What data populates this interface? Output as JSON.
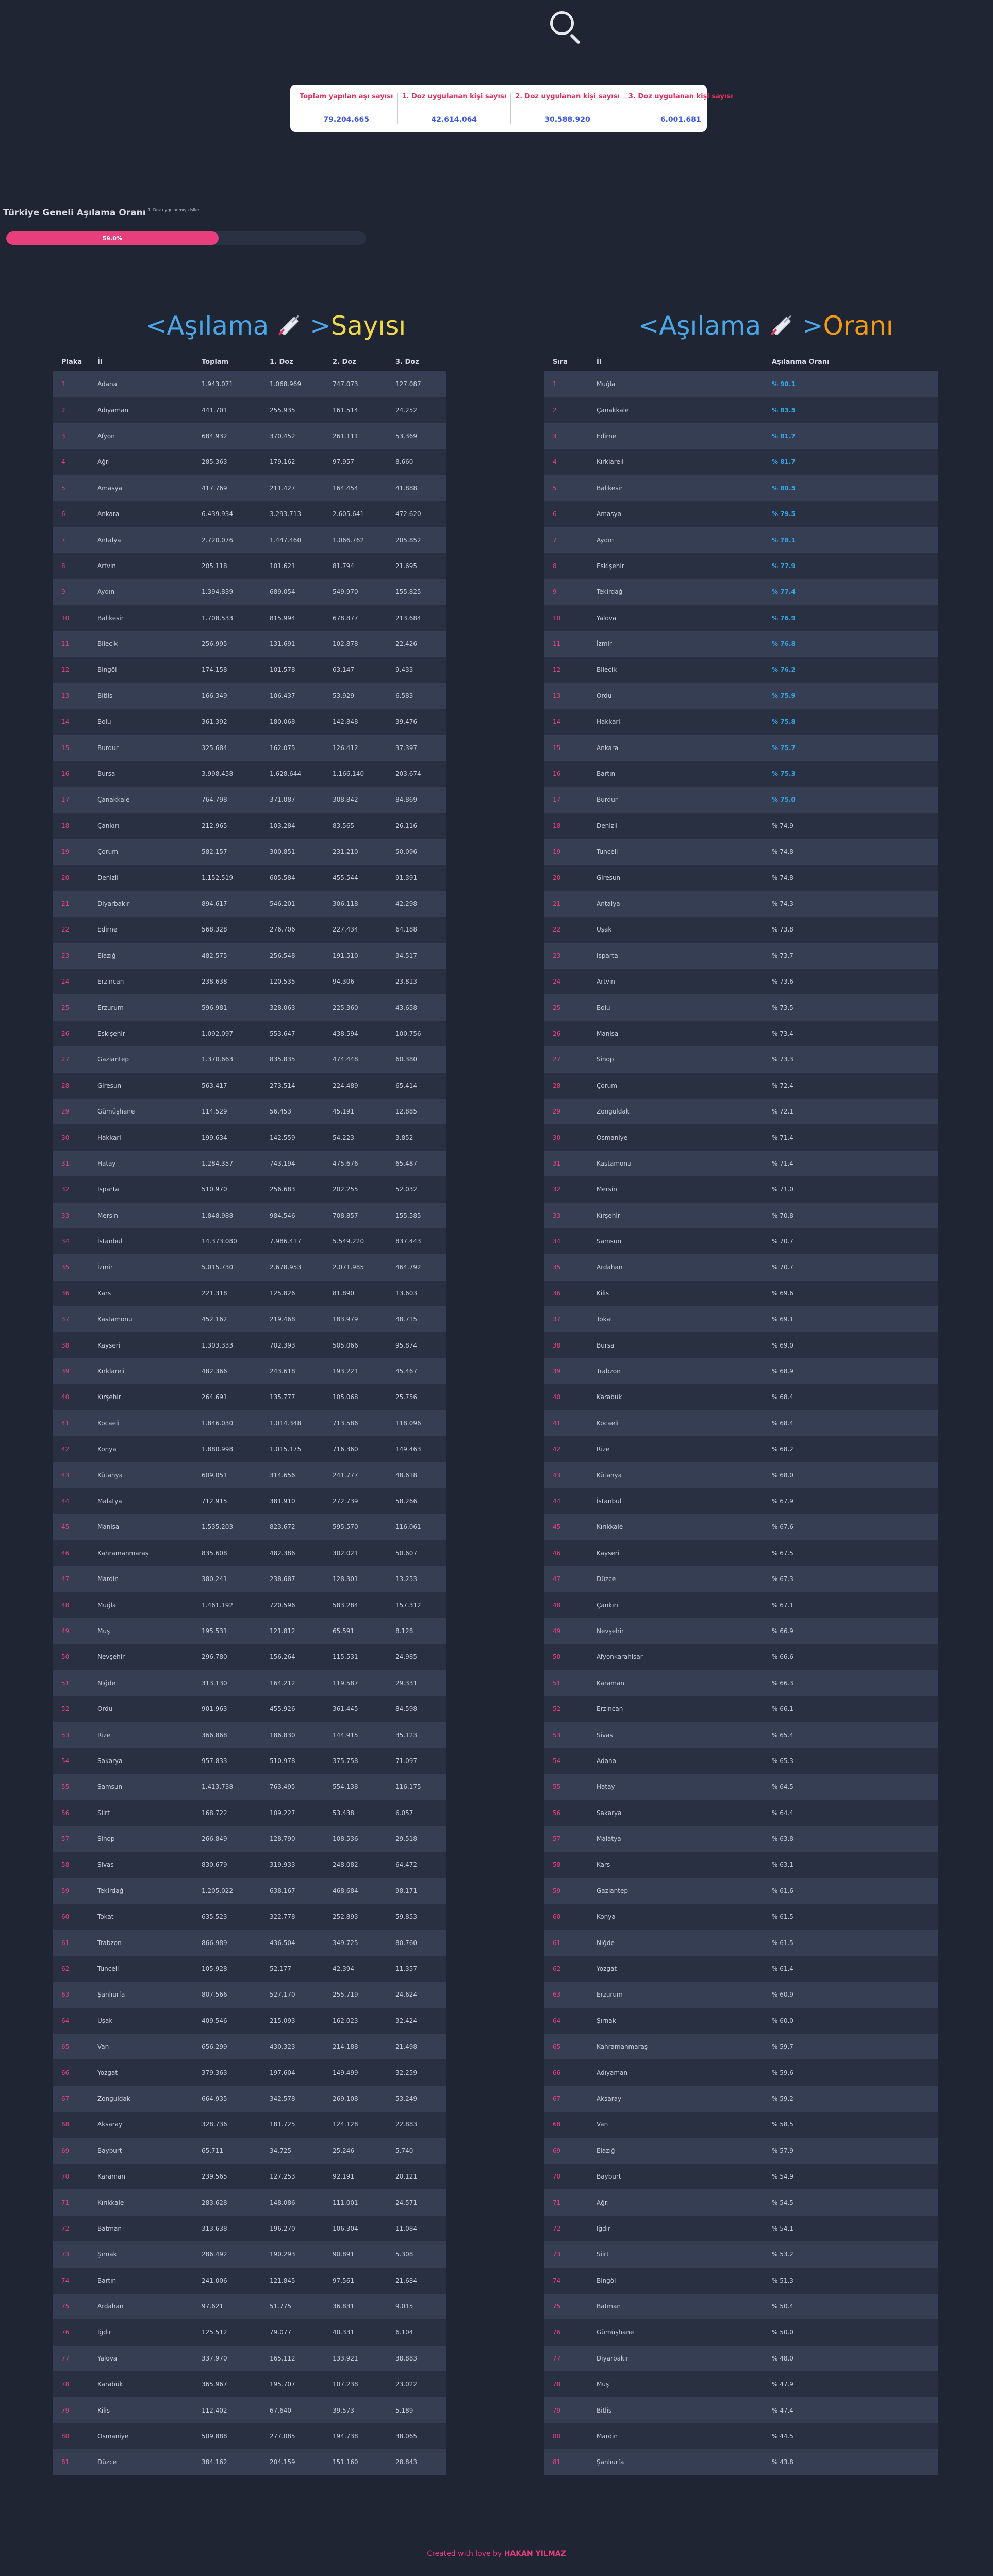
{
  "search": {
    "icon": "search-icon"
  },
  "stats": [
    {
      "label": "Toplam yapılan aşı sayısı",
      "value": "79.204.665"
    },
    {
      "label": "1. Doz uygulanan kişi sayısı",
      "value": "42.614.064"
    },
    {
      "label": "2. Doz uygulanan kişi sayısı",
      "value": "30.588.920"
    },
    {
      "label": "3. Doz uygulanan kişi sayısı",
      "value": "6.001.681"
    }
  ],
  "overall": {
    "title": "Türkiye Geneli Aşılama Oranı",
    "subtitle": "1. Doz uygulanmış kişiler",
    "percent_text": "59.0%",
    "percent": 59.0
  },
  "left_heading": {
    "open": "<",
    "word1": "Aşılama",
    "word2": "Sayısı",
    "close": ">",
    "icon": "syringe-icon"
  },
  "right_heading": {
    "open": "<",
    "word1": "Aşılama",
    "word2": "Oranı",
    "close": ">",
    "icon": "syringe-icon"
  },
  "left_table": {
    "headers": [
      "Plaka",
      "İl",
      "Toplam",
      "1. Doz",
      "2. Doz",
      "3. Doz"
    ],
    "rows": [
      [
        "1",
        "Adana",
        "1.943.071",
        "1.068.969",
        "747.073",
        "127.087"
      ],
      [
        "2",
        "Adıyaman",
        "441.701",
        "255.935",
        "161.514",
        "24.252"
      ],
      [
        "3",
        "Afyon",
        "684.932",
        "370.452",
        "261.111",
        "53.369"
      ],
      [
        "4",
        "Ağrı",
        "285.363",
        "179.162",
        "97.957",
        "8.660"
      ],
      [
        "5",
        "Amasya",
        "417.769",
        "211.427",
        "164.454",
        "41.888"
      ],
      [
        "6",
        "Ankara",
        "6.439.934",
        "3.293.713",
        "2.605.641",
        "472.620"
      ],
      [
        "7",
        "Antalya",
        "2.720.076",
        "1.447.460",
        "1.066.762",
        "205.852"
      ],
      [
        "8",
        "Artvin",
        "205.118",
        "101.621",
        "81.794",
        "21.695"
      ],
      [
        "9",
        "Aydın",
        "1.394.839",
        "689.054",
        "549.970",
        "155.825"
      ],
      [
        "10",
        "Balıkesir",
        "1.708.533",
        "815.994",
        "678.877",
        "213.684"
      ],
      [
        "11",
        "Bilecik",
        "256.995",
        "131.691",
        "102.878",
        "22.426"
      ],
      [
        "12",
        "Bingöl",
        "174.158",
        "101.578",
        "63.147",
        "9.433"
      ],
      [
        "13",
        "Bitlis",
        "166.349",
        "106.437",
        "53.929",
        "6.583"
      ],
      [
        "14",
        "Bolu",
        "361.392",
        "180.068",
        "142.848",
        "39.476"
      ],
      [
        "15",
        "Burdur",
        "325.684",
        "162.075",
        "126.412",
        "37.397"
      ],
      [
        "16",
        "Bursa",
        "3.998.458",
        "1.628.644",
        "1.166.140",
        "203.674"
      ],
      [
        "17",
        "Çanakkale",
        "764.798",
        "371.087",
        "308.842",
        "84.869"
      ],
      [
        "18",
        "Çankırı",
        "212.965",
        "103.284",
        "83.565",
        "26.116"
      ],
      [
        "19",
        "Çorum",
        "582.157",
        "300.851",
        "231.210",
        "50.096"
      ],
      [
        "20",
        "Denizli",
        "1.152.519",
        "605.584",
        "455.544",
        "91.391"
      ],
      [
        "21",
        "Diyarbakır",
        "894.617",
        "546.201",
        "306.118",
        "42.298"
      ],
      [
        "22",
        "Edirne",
        "568.328",
        "276.706",
        "227.434",
        "64.188"
      ],
      [
        "23",
        "Elazığ",
        "482.575",
        "256.548",
        "191.510",
        "34.517"
      ],
      [
        "24",
        "Erzincan",
        "238.638",
        "120.535",
        "94.306",
        "23.813"
      ],
      [
        "25",
        "Erzurum",
        "596.981",
        "328.063",
        "225.360",
        "43.658"
      ],
      [
        "26",
        "Eskişehir",
        "1.092.097",
        "553.647",
        "438.594",
        "100.756"
      ],
      [
        "27",
        "Gaziantep",
        "1.370.663",
        "835.835",
        "474.448",
        "60.380"
      ],
      [
        "28",
        "Giresun",
        "563.417",
        "273.514",
        "224.489",
        "65.414"
      ],
      [
        "29",
        "Gümüşhane",
        "114.529",
        "56.453",
        "45.191",
        "12.885"
      ],
      [
        "30",
        "Hakkari",
        "199.634",
        "142.559",
        "54.223",
        "3.852"
      ],
      [
        "31",
        "Hatay",
        "1.284.357",
        "743.194",
        "475.676",
        "65.487"
      ],
      [
        "32",
        "Isparta",
        "510.970",
        "256.683",
        "202.255",
        "52.032"
      ],
      [
        "33",
        "Mersin",
        "1.848.988",
        "984.546",
        "708.857",
        "155.585"
      ],
      [
        "34",
        "İstanbul",
        "14.373.080",
        "7.986.417",
        "5.549.220",
        "837.443"
      ],
      [
        "35",
        "İzmir",
        "5.015.730",
        "2.678.953",
        "2.071.985",
        "464.792"
      ],
      [
        "36",
        "Kars",
        "221.318",
        "125.826",
        "81.890",
        "13.603"
      ],
      [
        "37",
        "Kastamonu",
        "452.162",
        "219.468",
        "183.979",
        "48.715"
      ],
      [
        "38",
        "Kayseri",
        "1.303.333",
        "702.393",
        "505.066",
        "95.874"
      ],
      [
        "39",
        "Kırklareli",
        "482.366",
        "243.618",
        "193.221",
        "45.467"
      ],
      [
        "40",
        "Kırşehir",
        "264.691",
        "135.777",
        "105.068",
        "25.756"
      ],
      [
        "41",
        "Kocaeli",
        "1.846.030",
        "1.014.348",
        "713.586",
        "118.096"
      ],
      [
        "42",
        "Konya",
        "1.880.998",
        "1.015.175",
        "716.360",
        "149.463"
      ],
      [
        "43",
        "Kütahya",
        "609.051",
        "314.656",
        "241.777",
        "48.618"
      ],
      [
        "44",
        "Malatya",
        "712.915",
        "381.910",
        "272.739",
        "58.266"
      ],
      [
        "45",
        "Manisa",
        "1.535.203",
        "823.672",
        "595.570",
        "116.061"
      ],
      [
        "46",
        "Kahramanmaraş",
        "835.608",
        "482.386",
        "302.021",
        "50.607"
      ],
      [
        "47",
        "Mardin",
        "380.241",
        "238.687",
        "128.301",
        "13.253"
      ],
      [
        "48",
        "Muğla",
        "1.461.192",
        "720.596",
        "583.284",
        "157.312"
      ],
      [
        "49",
        "Muş",
        "195.531",
        "121.812",
        "65.591",
        "8.128"
      ],
      [
        "50",
        "Nevşehir",
        "296.780",
        "156.264",
        "115.531",
        "24.985"
      ],
      [
        "51",
        "Niğde",
        "313.130",
        "164.212",
        "119.587",
        "29.331"
      ],
      [
        "52",
        "Ordu",
        "901.963",
        "455.926",
        "361.445",
        "84.598"
      ],
      [
        "53",
        "Rize",
        "366.868",
        "186.830",
        "144.915",
        "35.123"
      ],
      [
        "54",
        "Sakarya",
        "957.833",
        "510.978",
        "375.758",
        "71.097"
      ],
      [
        "55",
        "Samsun",
        "1.413.738",
        "763.495",
        "554.138",
        "116.175"
      ],
      [
        "56",
        "Siirt",
        "168.722",
        "109.227",
        "53.438",
        "6.057"
      ],
      [
        "57",
        "Sinop",
        "266.849",
        "128.790",
        "108.536",
        "29.518"
      ],
      [
        "58",
        "Sivas",
        "830.679",
        "319.933",
        "248.082",
        "64.472"
      ],
      [
        "59",
        "Tekirdağ",
        "1.205.022",
        "638.167",
        "468.684",
        "98.171"
      ],
      [
        "60",
        "Tokat",
        "635.523",
        "322.778",
        "252.893",
        "59.853"
      ],
      [
        "61",
        "Trabzon",
        "866.989",
        "436.504",
        "349.725",
        "80.760"
      ],
      [
        "62",
        "Tunceli",
        "105.928",
        "52.177",
        "42.394",
        "11.357"
      ],
      [
        "63",
        "Şanlıurfa",
        "807.566",
        "527.170",
        "255.719",
        "24.624"
      ],
      [
        "64",
        "Uşak",
        "409.546",
        "215.093",
        "162.023",
        "32.424"
      ],
      [
        "65",
        "Van",
        "656.299",
        "430.323",
        "214.188",
        "21.498"
      ],
      [
        "66",
        "Yozgat",
        "379.363",
        "197.604",
        "149.499",
        "32.259"
      ],
      [
        "67",
        "Zonguldak",
        "664.935",
        "342.578",
        "269.108",
        "53.249"
      ],
      [
        "68",
        "Aksaray",
        "328.736",
        "181.725",
        "124.128",
        "22.883"
      ],
      [
        "69",
        "Bayburt",
        "65.711",
        "34.725",
        "25.246",
        "5.740"
      ],
      [
        "70",
        "Karaman",
        "239.565",
        "127.253",
        "92.191",
        "20.121"
      ],
      [
        "71",
        "Kırıkkale",
        "283.628",
        "148.086",
        "111.001",
        "24.571"
      ],
      [
        "72",
        "Batman",
        "313.638",
        "196.270",
        "106.304",
        "11.084"
      ],
      [
        "73",
        "Şırnak",
        "286.492",
        "190.293",
        "90.891",
        "5.308"
      ],
      [
        "74",
        "Bartın",
        "241.006",
        "121.845",
        "97.561",
        "21.684"
      ],
      [
        "75",
        "Ardahan",
        "97.621",
        "51.775",
        "36.831",
        "9.015"
      ],
      [
        "76",
        "Iğdır",
        "125.512",
        "79.077",
        "40.331",
        "6.104"
      ],
      [
        "77",
        "Yalova",
        "337.970",
        "165.112",
        "133.921",
        "38.883"
      ],
      [
        "78",
        "Karabük",
        "365.967",
        "195.707",
        "107.238",
        "23.022"
      ],
      [
        "79",
        "Kilis",
        "112.402",
        "67.640",
        "39.573",
        "5.189"
      ],
      [
        "80",
        "Osmaniye",
        "509.888",
        "277.085",
        "194.738",
        "38.065"
      ],
      [
        "81",
        "Düzce",
        "384.162",
        "204.159",
        "151.160",
        "28.843"
      ]
    ]
  },
  "right_table": {
    "headers": [
      "Sıra",
      "İl",
      "Aşılanma Oranı"
    ],
    "rows": [
      [
        "1",
        "Muğla",
        "% 90.1"
      ],
      [
        "2",
        "Çanakkale",
        "% 83.5"
      ],
      [
        "3",
        "Edirne",
        "% 81.7"
      ],
      [
        "4",
        "Kırklareli",
        "% 81.7"
      ],
      [
        "5",
        "Balıkesir",
        "% 80.5"
      ],
      [
        "6",
        "Amasya",
        "% 79.5"
      ],
      [
        "7",
        "Aydın",
        "% 78.1"
      ],
      [
        "8",
        "Eskişehir",
        "% 77.9"
      ],
      [
        "9",
        "Tekirdağ",
        "% 77.4"
      ],
      [
        "10",
        "Yalova",
        "% 76.9"
      ],
      [
        "11",
        "İzmir",
        "% 76.8"
      ],
      [
        "12",
        "Bilecik",
        "% 76.2"
      ],
      [
        "13",
        "Ordu",
        "% 75.9"
      ],
      [
        "14",
        "Hakkari",
        "% 75.8"
      ],
      [
        "15",
        "Ankara",
        "% 75.7"
      ],
      [
        "16",
        "Bartın",
        "% 75.3"
      ],
      [
        "17",
        "Burdur",
        "% 75.0"
      ],
      [
        "18",
        "Denizli",
        "% 74.9"
      ],
      [
        "19",
        "Tunceli",
        "% 74.8"
      ],
      [
        "20",
        "Giresun",
        "% 74.8"
      ],
      [
        "21",
        "Antalya",
        "% 74.3"
      ],
      [
        "22",
        "Uşak",
        "% 73.8"
      ],
      [
        "23",
        "Isparta",
        "% 73.7"
      ],
      [
        "24",
        "Artvin",
        "% 73.6"
      ],
      [
        "25",
        "Bolu",
        "% 73.5"
      ],
      [
        "26",
        "Manisa",
        "% 73.4"
      ],
      [
        "27",
        "Sinop",
        "% 73.3"
      ],
      [
        "28",
        "Çorum",
        "% 72.4"
      ],
      [
        "29",
        "Zonguldak",
        "% 72.1"
      ],
      [
        "30",
        "Osmaniye",
        "% 71.4"
      ],
      [
        "31",
        "Kastamonu",
        "% 71.4"
      ],
      [
        "32",
        "Mersin",
        "% 71.0"
      ],
      [
        "33",
        "Kırşehir",
        "% 70.8"
      ],
      [
        "34",
        "Samsun",
        "% 70.7"
      ],
      [
        "35",
        "Ardahan",
        "% 70.7"
      ],
      [
        "36",
        "Kilis",
        "% 69.6"
      ],
      [
        "37",
        "Tokat",
        "% 69.1"
      ],
      [
        "38",
        "Bursa",
        "% 69.0"
      ],
      [
        "39",
        "Trabzon",
        "% 68.9"
      ],
      [
        "40",
        "Karabük",
        "% 68.4"
      ],
      [
        "41",
        "Kocaeli",
        "% 68.4"
      ],
      [
        "42",
        "Rize",
        "% 68.2"
      ],
      [
        "43",
        "Kütahya",
        "% 68.0"
      ],
      [
        "44",
        "İstanbul",
        "% 67.9"
      ],
      [
        "45",
        "Kırıkkale",
        "% 67.6"
      ],
      [
        "46",
        "Kayseri",
        "% 67.5"
      ],
      [
        "47",
        "Düzce",
        "% 67.3"
      ],
      [
        "48",
        "Çankırı",
        "% 67.1"
      ],
      [
        "49",
        "Nevşehir",
        "% 66.9"
      ],
      [
        "50",
        "Afyonkarahisar",
        "% 66.6"
      ],
      [
        "51",
        "Karaman",
        "% 66.3"
      ],
      [
        "52",
        "Erzincan",
        "% 66.1"
      ],
      [
        "53",
        "Sivas",
        "% 65.4"
      ],
      [
        "54",
        "Adana",
        "% 65.3"
      ],
      [
        "55",
        "Hatay",
        "% 64.5"
      ],
      [
        "56",
        "Sakarya",
        "% 64.4"
      ],
      [
        "57",
        "Malatya",
        "% 63.8"
      ],
      [
        "58",
        "Kars",
        "% 63.1"
      ],
      [
        "59",
        "Gaziantep",
        "% 61.6"
      ],
      [
        "60",
        "Konya",
        "% 61.5"
      ],
      [
        "61",
        "Niğde",
        "% 61.5"
      ],
      [
        "62",
        "Yozgat",
        "% 61.4"
      ],
      [
        "63",
        "Erzurum",
        "% 60.9"
      ],
      [
        "64",
        "Şırnak",
        "% 60.0"
      ],
      [
        "65",
        "Kahramanmaraş",
        "% 59.7"
      ],
      [
        "66",
        "Adıyaman",
        "% 59.6"
      ],
      [
        "67",
        "Aksaray",
        "% 59.2"
      ],
      [
        "68",
        "Van",
        "% 58.5"
      ],
      [
        "69",
        "Elazığ",
        "% 57.9"
      ],
      [
        "70",
        "Bayburt",
        "% 54.9"
      ],
      [
        "71",
        "Ağrı",
        "% 54.5"
      ],
      [
        "72",
        "Iğdır",
        "% 54.1"
      ],
      [
        "73",
        "Siirt",
        "% 53.2"
      ],
      [
        "74",
        "Bingöl",
        "% 51.3"
      ],
      [
        "75",
        "Batman",
        "% 50.4"
      ],
      [
        "76",
        "Gümüşhane",
        "% 50.0"
      ],
      [
        "77",
        "Diyarbakır",
        "% 48.0"
      ],
      [
        "78",
        "Muş",
        "% 47.9"
      ],
      [
        "79",
        "Bitlis",
        "% 47.4"
      ],
      [
        "80",
        "Mardin",
        "% 44.5"
      ],
      [
        "81",
        "Şanlıurfa",
        "% 43.8"
      ]
    ]
  },
  "footer": {
    "prefix": "Created with love by",
    "author": "HAKAN YILMAZ"
  },
  "colors": {
    "background": "#1f2533",
    "accent": "#e83f7c",
    "blue": "#4aa8e8",
    "yellow": "#f0d848",
    "stat_value": "#3b55e6"
  }
}
